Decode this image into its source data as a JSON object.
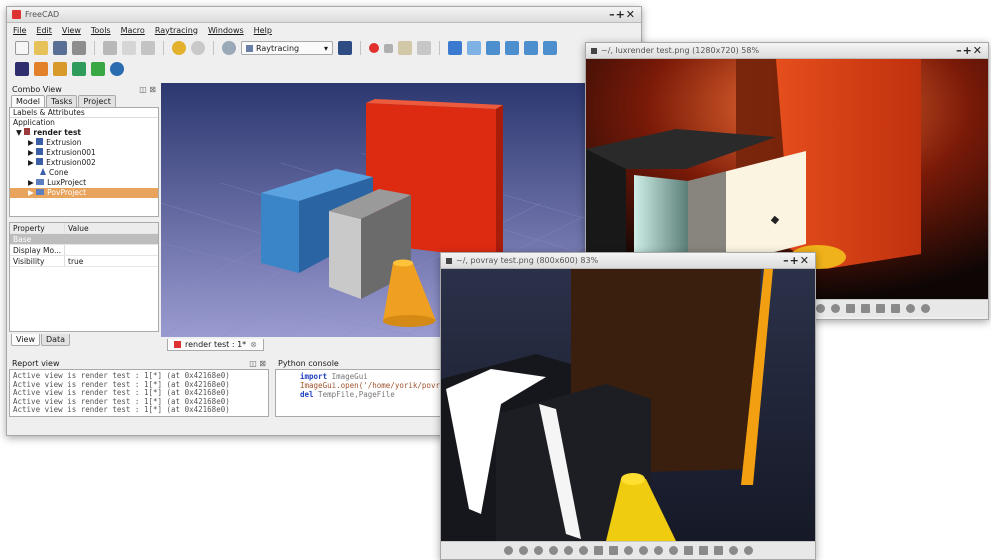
{
  "freecad": {
    "title": "FreeCAD",
    "controls": "–+✕",
    "menu": [
      "File",
      "Edit",
      "View",
      "Tools",
      "Macro",
      "Raytracing",
      "Windows",
      "Help"
    ],
    "workbench": "Raytracing",
    "combo_view": {
      "title": "Combo View",
      "tabs": [
        "Model",
        "Tasks",
        "Project"
      ],
      "tree_header": "Labels & Attributes",
      "root": "Application",
      "document": "render test",
      "items": [
        "Extrusion",
        "Extrusion001",
        "Extrusion002",
        "Cone",
        "LuxProject",
        "PovProject"
      ],
      "props": {
        "col_property": "Property",
        "col_value": "Value",
        "group": "Base",
        "rows": [
          {
            "name": "Display Mo...",
            "value": ""
          },
          {
            "name": "Visibility",
            "value": "true"
          }
        ]
      },
      "bottom_tabs": [
        "View",
        "Data"
      ]
    },
    "doc_tab": "render test : 1*",
    "report_view": {
      "title": "Report view",
      "lines": [
        "Active view is render test : 1[*] (at 0x42168e0)",
        "Active view is render test : 1[*] (at 0x42168e0)",
        "Active view is render test : 1[*] (at 0x42168e0)",
        "Active view is render test : 1[*] (at 0x42168e0)",
        "Active view is render test : 1[*] (at 0x42168e0)"
      ]
    },
    "python_console": {
      "title": "Python console",
      "lines": [
        {
          "kw": "import",
          "rest": " ImageGui"
        },
        {
          "kw": "",
          "rest": "ImageGui.open('/home/yorik/povray"
        },
        {
          "kw": "del",
          "rest": " TempFile,PageFile"
        }
      ]
    }
  },
  "luxrender": {
    "title": "~/, luxrender test.png (1280x720) 58%",
    "controls": "–+✕"
  },
  "povray": {
    "title": "~/, povray test.png (800x600) 83%",
    "controls": "–+✕"
  },
  "colors": {
    "accent": "#e8a35c",
    "red_panel": "#e02a12",
    "blue_box": "#3a84c8",
    "cone": "#f0a020"
  }
}
